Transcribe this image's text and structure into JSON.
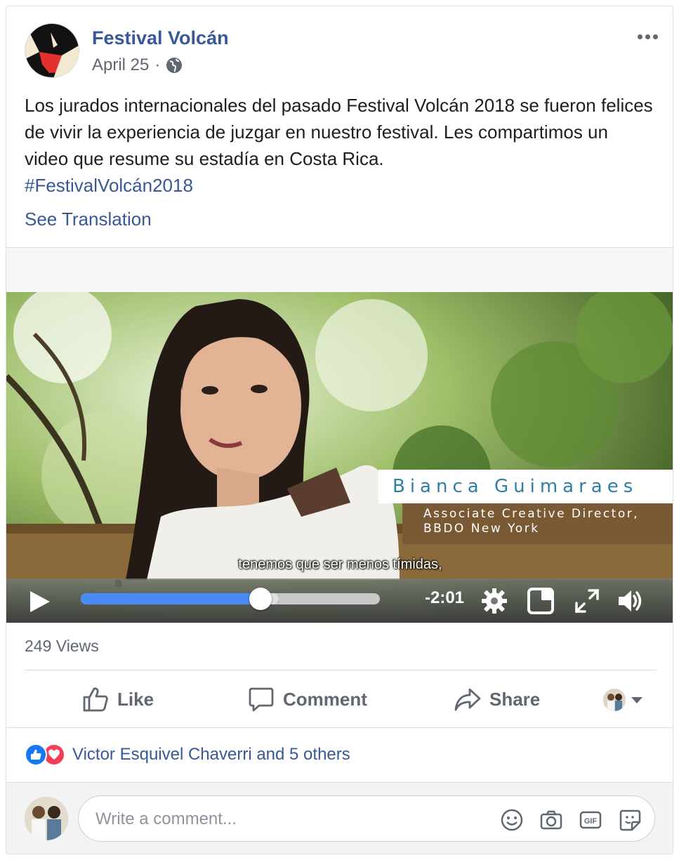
{
  "post": {
    "page_name": "Festival Volcán",
    "date": "April 25",
    "separator": "·",
    "privacy_icon": "globe-icon",
    "text": "Los jurados internacionales del pasado Festival Volcán 2018 se fueron felices de vivir la experiencia de juzgar en nuestro festival. Les compartimos un video que resume su estadía en Costa Rica.",
    "hashtag": "#FestivalVolcán2018",
    "see_translation": "See Translation"
  },
  "video": {
    "lower_third_name": "Bianca Guimaraes",
    "lower_third_title_line1": "Associate Creative Director,",
    "lower_third_title_line2": "BBDO New York",
    "subtitle": "tenemos que ser menos tímidas,",
    "time_remaining": "-2:01",
    "progress_fraction": 0.6,
    "buffered_fraction": 0.66,
    "progress_color": "#4a8af4"
  },
  "stats": {
    "views": "249 Views"
  },
  "actions": {
    "like": "Like",
    "comment": "Comment",
    "share": "Share"
  },
  "reactions": {
    "summary": "Victor Esquivel Chaverri and 5 others",
    "like_color": "#1877f2",
    "love_color": "#f33e58"
  },
  "comment_box": {
    "placeholder": "Write a comment..."
  },
  "colors": {
    "link_blue": "#385898",
    "secondary_text": "#606770"
  }
}
